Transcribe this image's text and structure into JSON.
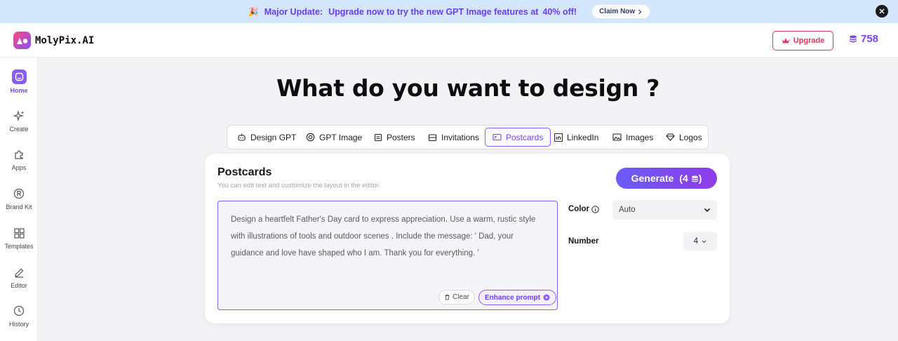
{
  "banner": {
    "prefix": "Major Update:",
    "message": "Upgrade now to try the new GPT Image features at",
    "discount": "40% off!",
    "claim_label": "Claim Now"
  },
  "header": {
    "app_name": "MolyPix.AI",
    "upgrade_label": "Upgrade",
    "credits": "758"
  },
  "sidebar": {
    "items": [
      {
        "label": "Home"
      },
      {
        "label": "Create"
      },
      {
        "label": "Apps"
      },
      {
        "label": "Brand Kit"
      },
      {
        "label": "Templates"
      },
      {
        "label": "Editor"
      },
      {
        "label": "History"
      }
    ]
  },
  "main": {
    "headline": "What do you want to design ?",
    "tabs": [
      {
        "label": "Design GPT"
      },
      {
        "label": "GPT Image"
      },
      {
        "label": "Posters"
      },
      {
        "label": "Invitations"
      },
      {
        "label": "Postcards"
      },
      {
        "label": "LinkedIn"
      },
      {
        "label": "Images"
      },
      {
        "label": "Logos"
      }
    ],
    "active_tab": "Postcards"
  },
  "card": {
    "title": "Postcards",
    "subtitle": "You can edit text and customize the layout in the editor.",
    "generate_label": "Generate",
    "generate_cost": "4",
    "prompt": "Design a heartfelt Father's Day card to express appreciation. Use a warm, rustic style with illustrations of tools and outdoor scenes . Include the message: ' Dad, your guidance and love have shaped who I am. Thank you for everything. '",
    "clear_label": "Clear",
    "enhance_label": "Enhance prompt",
    "color_label": "Color",
    "color_value": "Auto",
    "number_label": "Number",
    "number_value": "4"
  },
  "colors": {
    "accent": "#8b5cf6",
    "upgrade_border": "#e2355c",
    "banner_bg": "#d4e6fb"
  }
}
